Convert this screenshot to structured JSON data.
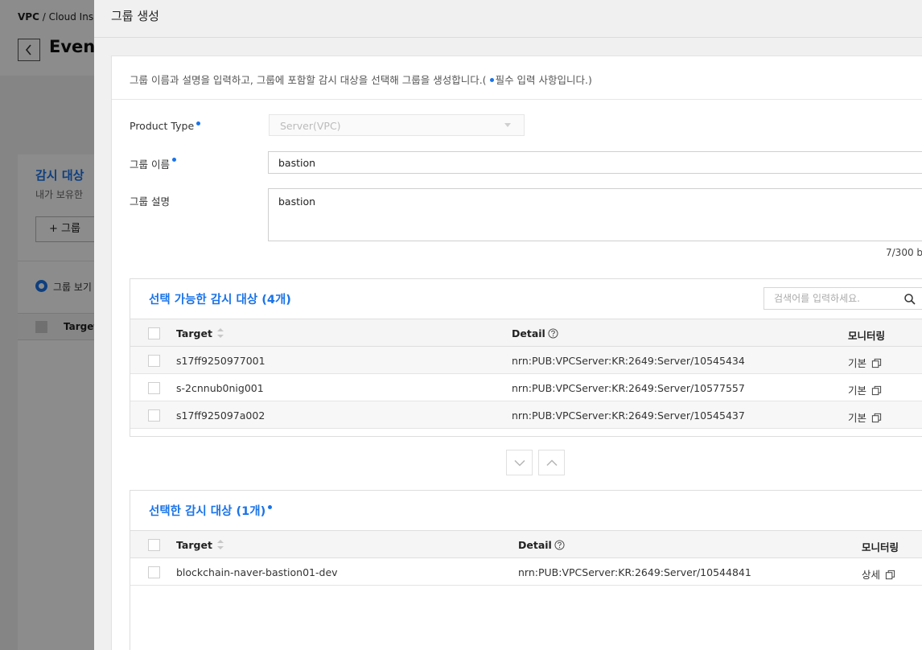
{
  "background": {
    "breadcrumb_root": "VPC",
    "breadcrumb_sep": "/",
    "breadcrumb_service": "Cloud Ins",
    "page_title": "Event",
    "panel_title": "감시 대상 ",
    "panel_subtitle": "내가 보유한 ",
    "add_group_button": "+ 그룹 ",
    "radio_label": "그룹 보기",
    "table_header_target": "Target"
  },
  "drawer": {
    "title": "그룹 생성",
    "intro_prefix": "그룹 이름과 설명을 입력하고, 그룹에 포함할 감시 대상을 선택해 그룹을 생성합니다.(",
    "intro_suffix": "필수 입력 사항입니다.)"
  },
  "form": {
    "product_type_label": "Product Type",
    "product_type_value": "Server(VPC)",
    "group_name_label": "그룹 이름",
    "group_name_value": "bastion",
    "group_desc_label": "그룹 설명",
    "group_desc_value": "bastion",
    "char_count": "7/300 b"
  },
  "available": {
    "title": "선택 가능한 감시 대상 (4개)",
    "search_placeholder": "검색어를 입력하세요.",
    "columns": {
      "target": "Target",
      "detail": "Detail",
      "monitoring": "모니터링"
    },
    "rows": [
      {
        "target": "s17ff9250977001",
        "detail": "nrn:PUB:VPCServer:KR:2649:Server/10545434",
        "monitoring": "기본"
      },
      {
        "target": "s-2cnnub0nig001",
        "detail": "nrn:PUB:VPCServer:KR:2649:Server/10577557",
        "monitoring": "기본"
      },
      {
        "target": "s17ff925097a002",
        "detail": "nrn:PUB:VPCServer:KR:2649:Server/10545437",
        "monitoring": "기본"
      }
    ]
  },
  "selected": {
    "title": "선택한 감시 대상 (1개)",
    "columns": {
      "target": "Target",
      "detail": "Detail",
      "monitoring": "모니터링"
    },
    "rows": [
      {
        "target": "blockchain-naver-bastion01-dev",
        "detail": "nrn:PUB:VPCServer:KR:2649:Server/10544841",
        "monitoring": "상세"
      }
    ]
  },
  "colors": {
    "accent": "#1a73e8"
  }
}
